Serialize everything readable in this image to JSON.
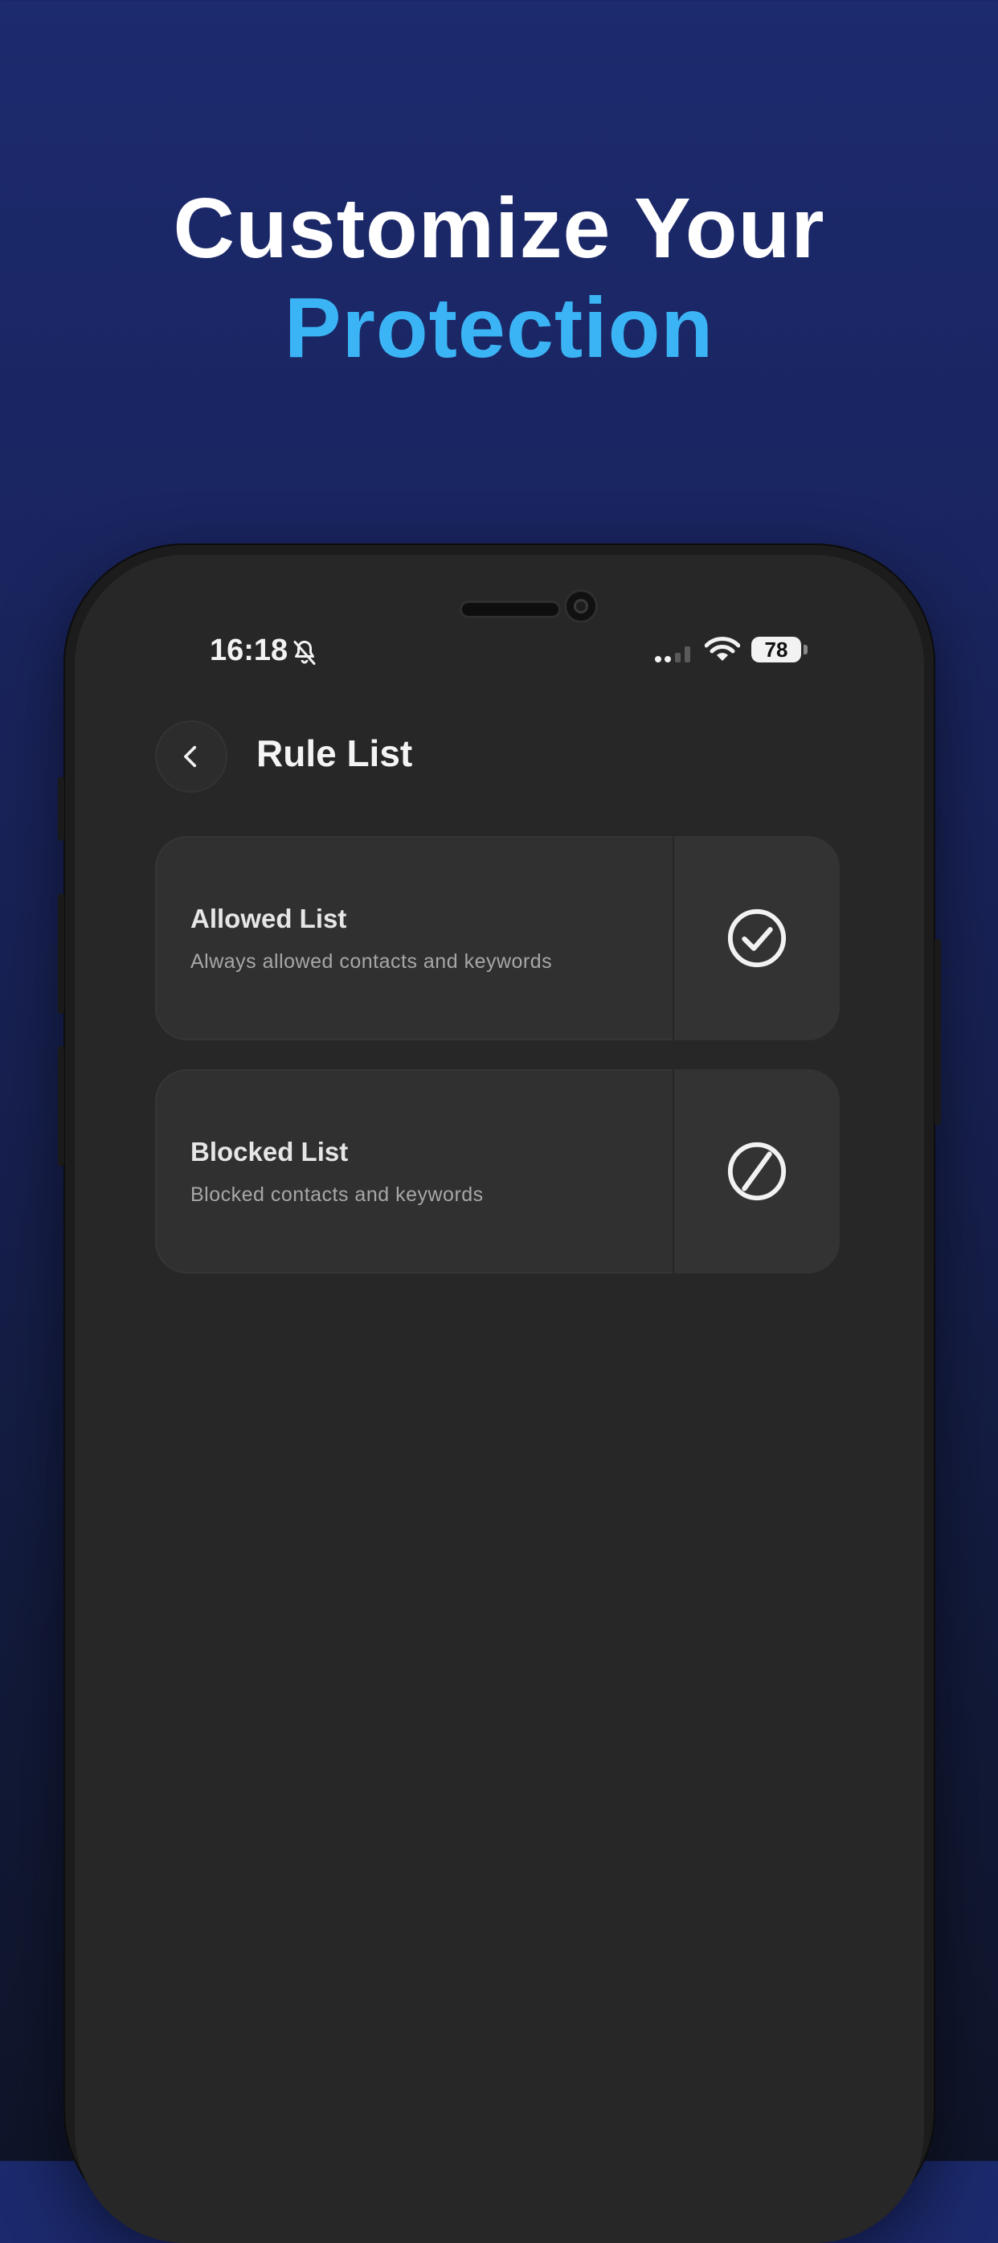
{
  "headline": {
    "line1": "Customize Your",
    "line2": "Protection"
  },
  "status_bar": {
    "time": "16:18",
    "battery": "78",
    "icons": [
      "bell-slash-icon",
      "signal-icon",
      "wifi-icon",
      "battery-icon"
    ]
  },
  "header": {
    "back_icon": "chevron-left-icon",
    "title": "Rule List"
  },
  "rules": [
    {
      "title": "Allowed List",
      "description": "Always allowed contacts and keywords",
      "icon": "check-circle-icon"
    },
    {
      "title": "Blocked List",
      "description": "Blocked contacts and keywords",
      "icon": "block-icon"
    }
  ],
  "colors": {
    "background_top": "#1c2a6e",
    "background_bottom": "#0f1529",
    "accent": "#3bb4f5",
    "screen": "#272727",
    "card": "#303030"
  }
}
